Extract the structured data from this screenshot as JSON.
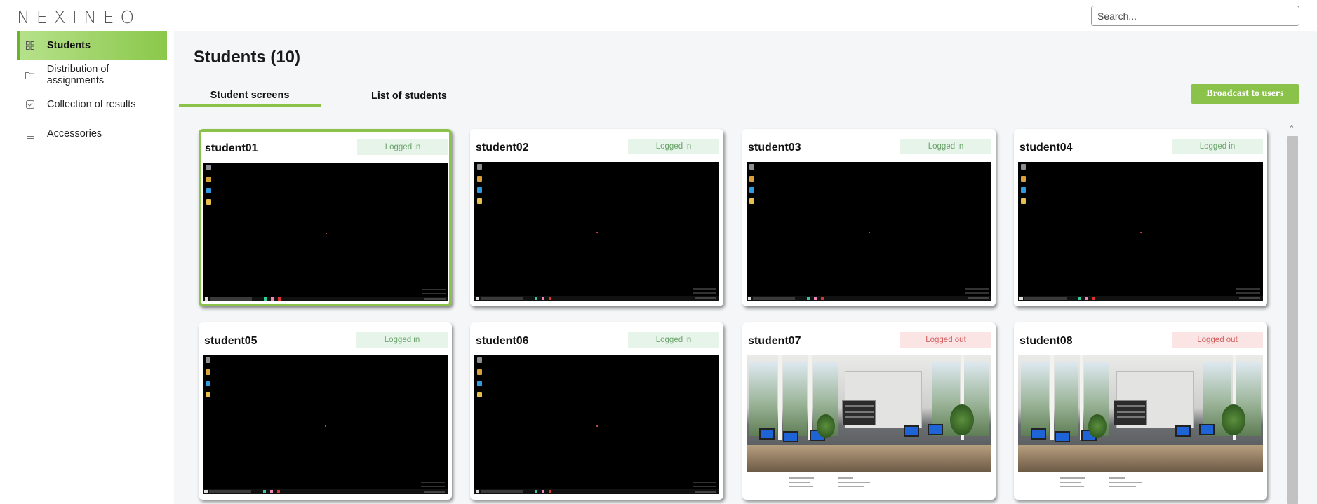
{
  "app": {
    "logo": "NEXINEO"
  },
  "search": {
    "placeholder": "Search..."
  },
  "sidebar": {
    "items": [
      {
        "label": "Students",
        "icon": "grid-icon",
        "active": true
      },
      {
        "label": "Distribution of assignments",
        "icon": "folder-icon",
        "active": false
      },
      {
        "label": "Collection of results",
        "icon": "checkbox-icon",
        "active": false
      },
      {
        "label": "Accessories",
        "icon": "device-icon",
        "active": false
      }
    ]
  },
  "main": {
    "title": "Students (10)",
    "tabs": [
      {
        "label": "Student screens",
        "active": true
      },
      {
        "label": "List of students",
        "active": false
      }
    ],
    "broadcast_label": "Broadcast to users"
  },
  "students": [
    {
      "name": "student01",
      "status": "Logged in",
      "screen": "desktop",
      "selected": true
    },
    {
      "name": "student02",
      "status": "Logged in",
      "screen": "desktop",
      "selected": false
    },
    {
      "name": "student03",
      "status": "Logged in",
      "screen": "desktop",
      "selected": false
    },
    {
      "name": "student04",
      "status": "Logged in",
      "screen": "desktop",
      "selected": false
    },
    {
      "name": "student05",
      "status": "Logged in",
      "screen": "desktop",
      "selected": false
    },
    {
      "name": "student06",
      "status": "Logged in",
      "screen": "desktop",
      "selected": false
    },
    {
      "name": "student07",
      "status": "Logged out",
      "screen": "lock-screen",
      "selected": false
    },
    {
      "name": "student08",
      "status": "Logged out",
      "screen": "lock-screen",
      "selected": false
    }
  ],
  "colors": {
    "accent": "#8bc34a",
    "logged_in_bg": "#e7f4ea",
    "logged_in_text": "#6aa36a",
    "logged_out_bg": "#fbe4e4",
    "logged_out_text": "#d36060"
  }
}
